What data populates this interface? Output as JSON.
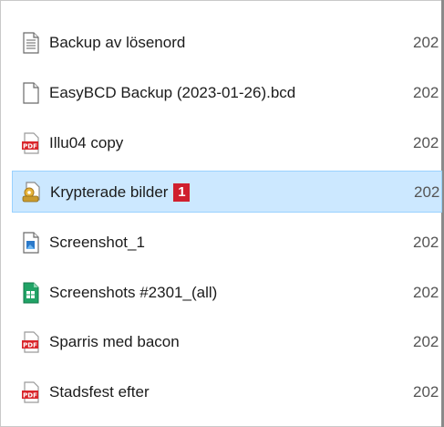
{
  "partial_top_text": "...",
  "files": [
    {
      "name": "Backup av lösenord",
      "date": "202",
      "icon": "text-file-icon",
      "selected": false
    },
    {
      "name": "EasyBCD Backup (2023-01-26).bcd",
      "date": "202",
      "icon": "blank-file-icon",
      "selected": false
    },
    {
      "name": "Illu04 copy",
      "date": "202",
      "icon": "pdf-file-icon",
      "selected": false
    },
    {
      "name": "Krypterade bilder",
      "date": "202",
      "icon": "encrypted-file-icon",
      "selected": true,
      "badge": "1"
    },
    {
      "name": "Screenshot_1",
      "date": "202",
      "icon": "image-file-icon",
      "selected": false
    },
    {
      "name": "Screenshots #2301_(all)",
      "date": "202",
      "icon": "spreadsheet-file-icon",
      "selected": false
    },
    {
      "name": "Sparris med bacon",
      "date": "202",
      "icon": "pdf-file-icon",
      "selected": false
    },
    {
      "name": "Stadsfest efter",
      "date": "202",
      "icon": "pdf-file-icon",
      "selected": false
    }
  ],
  "colors": {
    "selection_bg": "#cce8ff",
    "selection_border": "#99d1ff",
    "badge": "#d0202e",
    "pdf_red": "#d9262b",
    "sheet_green": "#21a366"
  }
}
